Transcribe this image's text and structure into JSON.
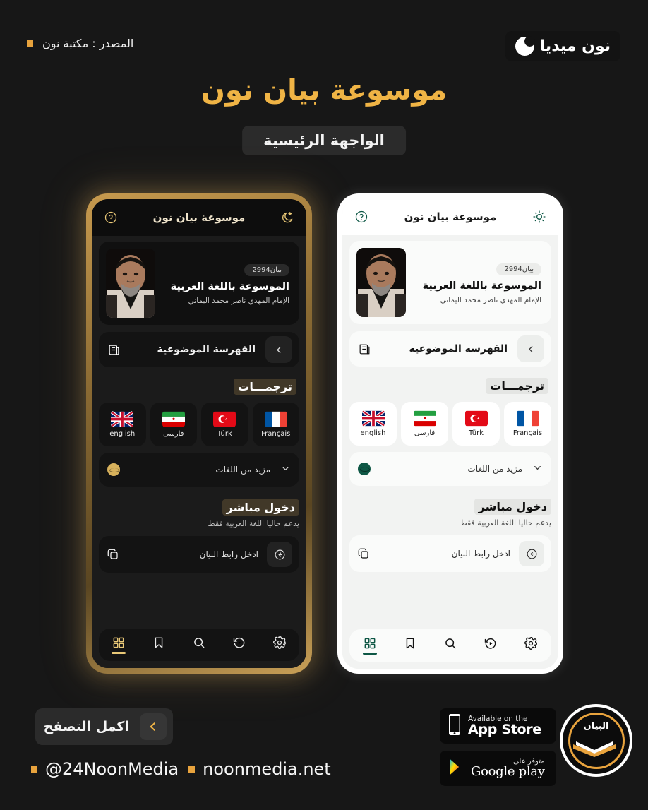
{
  "header": {
    "brand_name": "نون ميديا",
    "brand_icon": "crescent-moon-icon",
    "source_label": "المصدر : مكتبة نون",
    "main_title": "موسوعة بيان نون",
    "subtitle_pill": "الواجهة الرئيسية"
  },
  "app": {
    "header": {
      "title": "موسوعة بيان نون",
      "theme_toggle_dark_icon": "moon-star-icon",
      "theme_toggle_light_icon": "sun-icon",
      "help_icon": "question-circle-icon"
    },
    "hero": {
      "badge": "بيان2994",
      "title": "الموسوعة باللغة العربية",
      "subtitle": "الإمام المهدي ناصر محمد اليماني",
      "avatar_name": "avatar"
    },
    "index_row": {
      "label": "الفهرسة الموضوعية",
      "icon": "index-book-icon",
      "chevron": "chevron-left-icon"
    },
    "translations": {
      "heading": "ترجمـــات",
      "items": [
        {
          "label": "english",
          "flag": "uk-flag"
        },
        {
          "label": "فارسى",
          "flag": "iran-flag"
        },
        {
          "label": "Türk",
          "flag": "turkey-flag"
        },
        {
          "label": "Français",
          "flag": "france-flag"
        }
      ],
      "more_label": "مزيد من اللغات",
      "more_icon": "globe-icon",
      "more_caret": "chevron-down-icon"
    },
    "direct_access": {
      "heading": "دخول مباشر",
      "note": "يدعم حاليا اللغة العربية فقط",
      "link_label": "ادخل رابط البيان",
      "link_icon": "copy-icon",
      "go_icon": "arrow-left-circle-icon"
    },
    "bottom_nav": [
      {
        "name": "grid",
        "icon": "grid-icon",
        "active": true
      },
      {
        "name": "bookmark",
        "icon": "bookmark-icon",
        "active": false
      },
      {
        "name": "search",
        "icon": "search-icon",
        "active": false
      },
      {
        "name": "history",
        "icon": "play-history-icon",
        "active": false
      },
      {
        "name": "settings",
        "icon": "gear-icon",
        "active": false
      }
    ]
  },
  "footer": {
    "browse_button": "اكمل التصفح",
    "browse_chevron": "chevron-left-icon",
    "handles": [
      {
        "text": "@24NoonMedia"
      },
      {
        "text": "noonmedia.net"
      }
    ],
    "app_store": {
      "small": "Available on the",
      "big": "App Store",
      "icon": "iphone-icon"
    },
    "google_play": {
      "small": "متوفر على",
      "big": "Google play",
      "icon": "play-triangle-icon"
    },
    "bayan_logo_word": "البيان"
  },
  "colors": {
    "background": "#171717",
    "gold": "#f0b445",
    "gold_soft": "#e9c877",
    "teal": "#0e5745",
    "orange_square": "#e8a33d",
    "dark_panel": "#131313",
    "light_panel": "#fafbfa"
  }
}
